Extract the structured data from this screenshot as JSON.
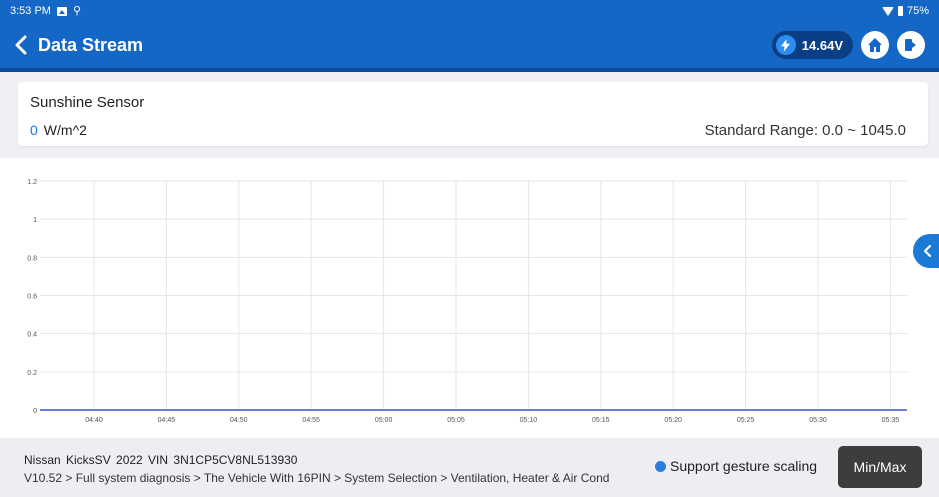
{
  "status_bar": {
    "time": "3:53 PM",
    "battery": "75%"
  },
  "app_bar": {
    "title": "Data Stream",
    "voltage": "14.64V"
  },
  "sensor": {
    "name": "Sunshine Sensor",
    "value": "0",
    "unit": "W/m^2",
    "range_label": "Standard Range:",
    "range_value": "0.0 ~ 1045.0"
  },
  "chart_data": {
    "type": "line",
    "title": "",
    "xlabel": "",
    "ylabel": "",
    "y_ticks": [
      "1.2",
      "1",
      "0.8",
      "0.6",
      "0.4",
      "0.2",
      "0"
    ],
    "x_ticks": [
      "04:40",
      "04:45",
      "04:50",
      "04:55",
      "05:00",
      "05:05",
      "05:10",
      "05:15",
      "05:20",
      "05:25",
      "05:30",
      "05:35"
    ],
    "ylim": [
      0,
      1.2
    ],
    "grid": true,
    "series": [
      {
        "values": [
          0,
          0,
          0,
          0,
          0,
          0,
          0,
          0,
          0,
          0,
          0,
          0
        ],
        "color": "#3f51d6"
      }
    ]
  },
  "bottom": {
    "vehicle": "Nissan  KicksSV  2022  VIN  3N1CP5CV8NL513930",
    "path": "V10.52 > Full system diagnosis > The Vehicle With 16PIN > System Selection > Ventilation, Heater & Air Cond",
    "gesture_hint": "Support gesture scaling",
    "minmax_label": "Min/Max"
  },
  "colors": {
    "primary": "#1467c4",
    "accent": "#1a7ad6",
    "series": "#3f51d6"
  }
}
